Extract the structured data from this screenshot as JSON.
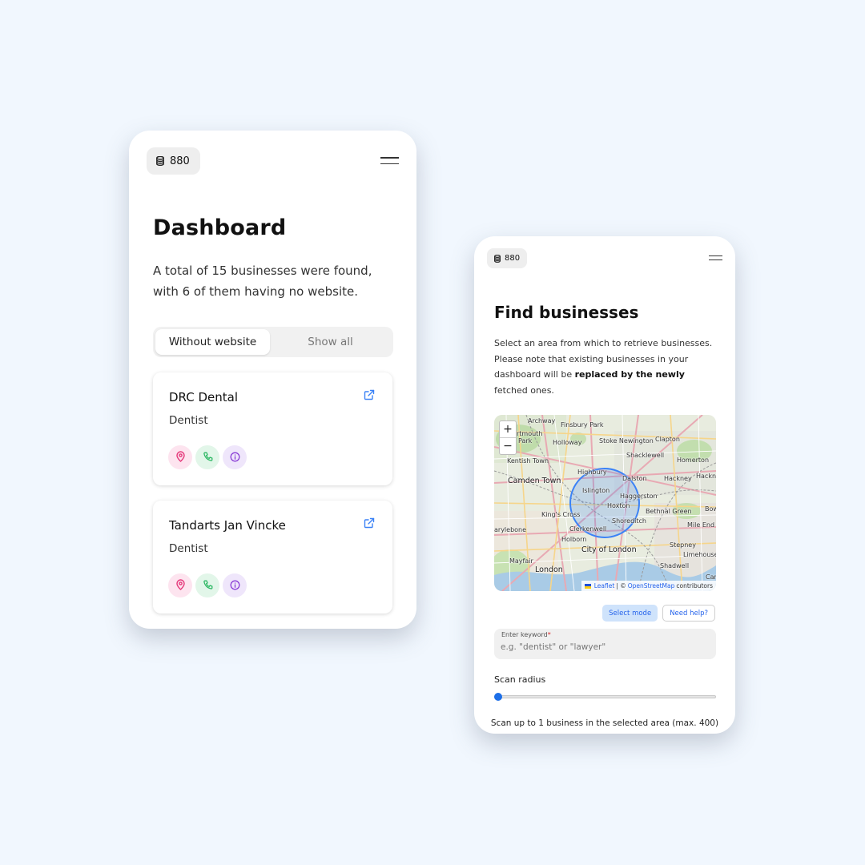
{
  "dashboard": {
    "credits": "880",
    "title": "Dashboard",
    "summary": "A total of 15 businesses were found, with 6 of them having no website.",
    "tabs": [
      {
        "label": "Without website",
        "active": true
      },
      {
        "label": "Show all",
        "active": false
      }
    ],
    "businesses": [
      {
        "name": "DRC Dental",
        "category": "Dentist"
      },
      {
        "name": "Tandarts Jan Vincke",
        "category": "Dentist"
      }
    ],
    "icons": {
      "credits": "database-icon",
      "menu": "hamburger-menu-icon",
      "link": "external-link-icon",
      "location": "map-pin-icon",
      "phone": "phone-icon",
      "info": "info-icon"
    },
    "colors": {
      "pink": "#e5387a",
      "green": "#2fb865",
      "purple": "#8b3fd6",
      "link": "#3b82f6"
    }
  },
  "finder": {
    "credits": "880",
    "title": "Find businesses",
    "desc_part1": "Select an area from which to retrieve businesses. Please note that existing businesses in your dashboard will be ",
    "desc_bold": "replaced by the newly",
    "desc_part2": " fetched ones.",
    "map": {
      "zoom_in": "+",
      "zoom_out": "−",
      "attribution_leaflet": "Leaflet",
      "attribution_sep": "| ©",
      "attribution_osm": "OpenStreetMap",
      "attribution_contrib": "contributors",
      "labels": [
        {
          "text": "Archway"
        },
        {
          "text": "Finsbury Park"
        },
        {
          "text": "rtmouth"
        },
        {
          "text": "Park"
        },
        {
          "text": "Holloway"
        },
        {
          "text": "Stoke Newington"
        },
        {
          "text": "Clapton"
        },
        {
          "text": "Shacklewell"
        },
        {
          "text": "Kentish Town"
        },
        {
          "text": "Homerton"
        },
        {
          "text": "Camden Town"
        },
        {
          "text": "Highbury"
        },
        {
          "text": "Dalston"
        },
        {
          "text": "Hackney"
        },
        {
          "text": "Hackne"
        },
        {
          "text": "Islington"
        },
        {
          "text": "Haggerston"
        },
        {
          "text": "Hoxton"
        },
        {
          "text": "King's Cross"
        },
        {
          "text": "Bethnal Green"
        },
        {
          "text": "Bow"
        },
        {
          "text": "Shoreditch"
        },
        {
          "text": "arylebone"
        },
        {
          "text": "Clerkenwell"
        },
        {
          "text": "Mile End"
        },
        {
          "text": "Holborn"
        },
        {
          "text": "City of London"
        },
        {
          "text": "Stepney"
        },
        {
          "text": "Limehouse"
        },
        {
          "text": "Mayfair"
        },
        {
          "text": "London"
        },
        {
          "text": "Shadwell"
        },
        {
          "text": "Can"
        }
      ]
    },
    "select_mode": "Select mode",
    "need_help": "Need help?",
    "keyword_label": "Enter keyword",
    "keyword_required": "*",
    "keyword_placeholder": "e.g. \"dentist\" or \"lawyer\"",
    "keyword_value": "",
    "scan_radius_label": "Scan radius",
    "scan_radius_fraction": 0,
    "scan_note": "Scan up to 1 business in the selected area (max. 400)"
  }
}
